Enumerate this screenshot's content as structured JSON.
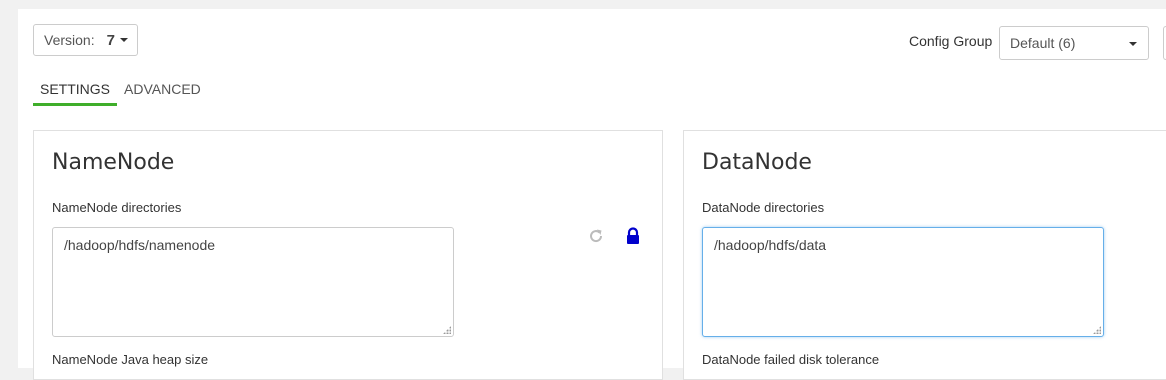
{
  "version": {
    "label": "Version:",
    "number": "7"
  },
  "config_group": {
    "label": "Config Group",
    "selected": "Default (6)"
  },
  "tabs": [
    {
      "label": "SETTINGS",
      "active": true
    },
    {
      "label": "ADVANCED",
      "active": false
    }
  ],
  "namenode": {
    "title": "NameNode",
    "dirs_label": "NameNode directories",
    "dirs_value": "/hadoop/hdfs/namenode",
    "heap_label": "NameNode Java heap size"
  },
  "datanode": {
    "title": "DataNode",
    "dirs_label": "DataNode directories",
    "dirs_value": "/hadoop/hdfs/data",
    "tolerance_label": "DataNode failed disk tolerance"
  },
  "colors": {
    "active_tab_underline": "#3fae2a",
    "lock_icon": "#0000cc",
    "focus_border": "#66afe9"
  },
  "icons": [
    "refresh-icon",
    "lock-icon",
    "chevron-down-icon",
    "resize-grip-icon"
  ]
}
